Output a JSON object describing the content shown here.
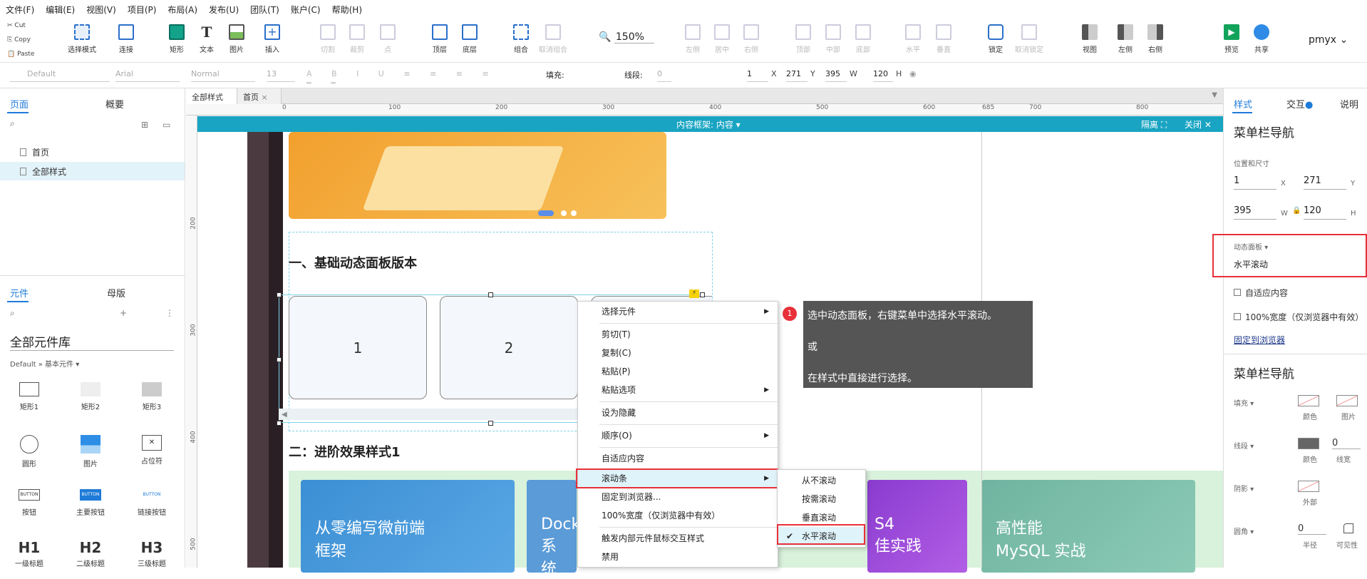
{
  "menu": [
    "文件(F)",
    "编辑(E)",
    "视图(V)",
    "项目(P)",
    "布局(A)",
    "发布(U)",
    "团队(T)",
    "账户(C)",
    "帮助(H)"
  ],
  "clipboard": {
    "cut": "Cut",
    "copy": "Copy",
    "paste": "Paste"
  },
  "toolbar": {
    "select": "选择模式",
    "connect": "连接",
    "rect": "矩形",
    "text": "文本",
    "image": "图片",
    "insert": "插入",
    "cut": "切割",
    "crop": "裁剪",
    "point": "点",
    "top": "顶层",
    "bottom": "底层",
    "group": "组合",
    "ungroup": "取消组合",
    "zoom": "150%",
    "left_align": "左侧",
    "center_align": "居中",
    "right_align": "右侧",
    "top_align": "顶部",
    "middle_align": "中部",
    "bottom_align": "底部",
    "horizontal": "水平",
    "vertical": "垂直",
    "lock": "锁定",
    "unlock": "取消锁定",
    "view": "视图",
    "left_panel": "左侧",
    "right_panel": "右侧",
    "preview": "预览",
    "share": "共享",
    "user": "pmyx"
  },
  "format": {
    "style": "Default",
    "font": "Arial",
    "weight": "Normal",
    "size": "13",
    "fill": "填充:",
    "stroke": "线段:",
    "stroke_val": "0",
    "x": "1",
    "y": "271",
    "w": "395",
    "h": "120",
    "xl": "X",
    "yl": "Y",
    "wl": "W",
    "hl": "H"
  },
  "leftpanel": {
    "tab_pages": "页面",
    "tab_outline": "概要",
    "pages": [
      "首页",
      "全部样式"
    ],
    "tab_widgets": "元件",
    "tab_masters": "母版",
    "library": "全部元件库",
    "lib_sub": "Default » 基本元件 ▾",
    "widgets": [
      "矩形1",
      "矩形2",
      "矩形3",
      "圆形",
      "图片",
      "占位符",
      "按钮",
      "主要按钮",
      "链接按钮",
      "一级标题",
      "二级标题",
      "三级标题"
    ],
    "btn_text": "BUTTON",
    "h_labels": [
      "H1",
      "H2",
      "H3"
    ]
  },
  "doctabs": [
    "全部样式",
    "首页"
  ],
  "ruler_h": [
    "0",
    "100",
    "200",
    "300",
    "400",
    "500",
    "600",
    "685",
    "700",
    "800"
  ],
  "ruler_v": [
    "200",
    "300",
    "400",
    "500"
  ],
  "frame": {
    "title": "内容框架: 内容 ▾",
    "hide": "隔离",
    "close": "关闭"
  },
  "canvas": {
    "section1": "一、基础动态面板版本",
    "section2": "二：进阶效果样式1",
    "box1": "1",
    "box2": "2",
    "card1a": "从零编写微前端",
    "card1b": "框架",
    "card2a": "Dock",
    "card2b": "系统",
    "card3a": "S4",
    "card3b": "佳实践",
    "card4a": "高性能",
    "card4b": "MySQL 实战"
  },
  "ctxmenu": [
    "选择元件",
    "剪切(T)",
    "复制(C)",
    "粘贴(P)",
    "粘贴选项",
    "设为隐藏",
    "顺序(O)",
    "自适应内容",
    "滚动条",
    "固定到浏览器...",
    "100%宽度（仅浏览器中有效）",
    "触发内部元件鼠标交互样式",
    "禁用"
  ],
  "submenu": [
    "从不滚动",
    "按需滚动",
    "垂直滚动",
    "水平滚动"
  ],
  "tooltip": {
    "num": "1",
    "line1": "选中动态面板，右键菜单中选择水平滚动。",
    "line2": "或",
    "line3": "在样式中直接进行选择。"
  },
  "rightpanel": {
    "tab_style": "样式",
    "tab_interact": "交互",
    "tab_note": "说明",
    "name": "菜单栏导航",
    "pos_size": "位置和尺寸",
    "x": "1",
    "y": "271",
    "w": "395",
    "h": "120",
    "xl": "X",
    "yl": "Y",
    "wl": "W",
    "hl": "H",
    "dp_label": "动态面板 ▾",
    "dp_value": "水平滚动",
    "fit": "自适应内容",
    "fullwidth": "100%宽度（仅浏览器中有效）",
    "pin": "固定到浏览器",
    "name2": "菜单栏导航",
    "fill": "填充 ▾",
    "color": "颜色",
    "image": "图片",
    "stroke": "线段 ▾",
    "stroke_color": "颜色",
    "stroke_w": "线宽",
    "stroke_val": "0",
    "shadow": "阴影 ▾",
    "outer": "外部",
    "radius": "圆角 ▾",
    "radius_val": "0",
    "radius_l": "半径",
    "visible": "可见性"
  }
}
